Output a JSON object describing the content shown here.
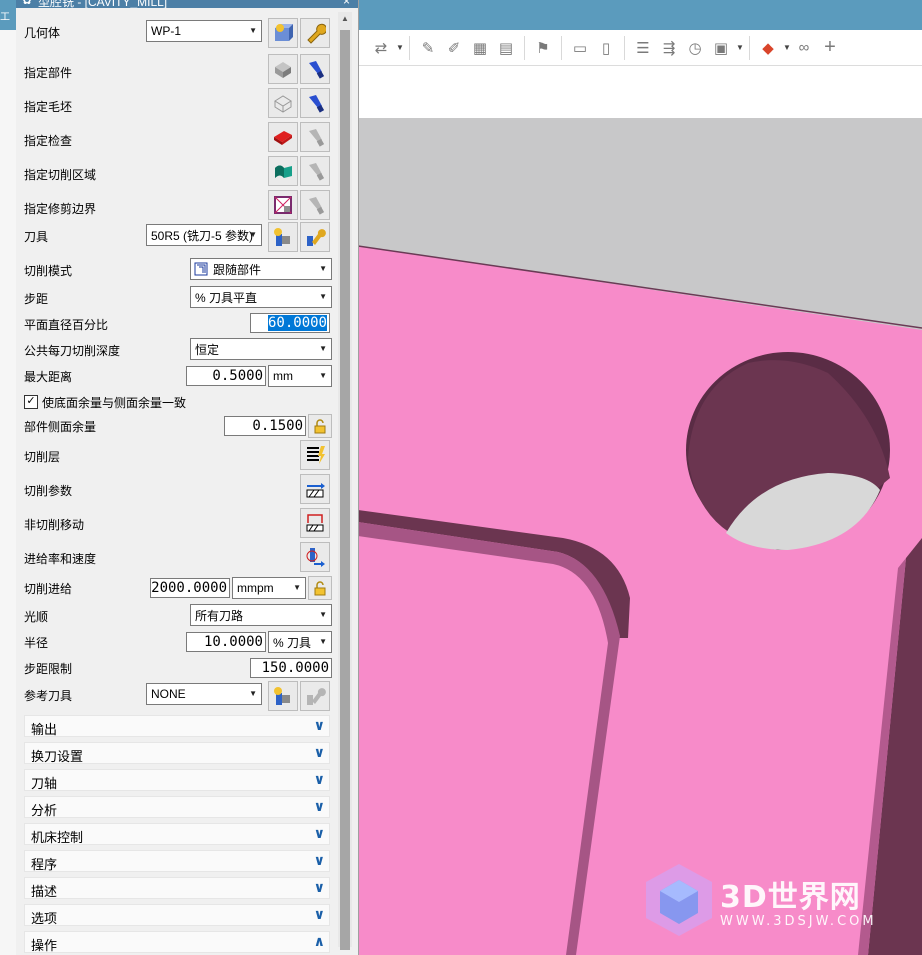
{
  "dialog": {
    "title": "型腔铣 - [CAVITY_MILL]",
    "close": "×",
    "rows": {
      "geometry_label": "几何体",
      "geometry_value": "WP-1",
      "part_label": "指定部件",
      "blank_label": "指定毛坯",
      "check_label": "指定检查",
      "cut_area_label": "指定切削区域",
      "trim_label": "指定修剪边界",
      "tool_label": "刀具",
      "tool_value": "50R5 (铣刀-5 参数)",
      "cut_pattern_label": "切削模式",
      "cut_pattern_value": "跟随部件",
      "stepover_label": "步距",
      "stepover_value": "% 刀具平直",
      "percent_label": "平面直径百分比",
      "percent_value": "60.0000",
      "depth_label": "公共每刀切削深度",
      "depth_value": "恒定",
      "maxdist_label": "最大距离",
      "maxdist_value": "0.5000",
      "maxdist_unit": "mm",
      "floor_check_label": "使底面余量与侧面余量一致",
      "floor_check_mark": "✓",
      "side_stock_label": "部件侧面余量",
      "side_stock_value": "0.1500",
      "levels_label": "切削层",
      "params_label": "切削参数",
      "noncut_label": "非切削移动",
      "feeds_label": "进给率和速度",
      "feed_label": "切削进给",
      "feed_value": "2000.0000",
      "feed_unit": "mmpm",
      "smooth_label": "光顺",
      "smooth_value": "所有刀路",
      "radius_label": "半径",
      "radius_value": "10.0000",
      "radius_unit": "% 刀具",
      "steplimit_label": "步距限制",
      "steplimit_value": "150.0000",
      "reftool_label": "参考刀具",
      "reftool_value": "NONE"
    },
    "sections": [
      {
        "label": "输出",
        "chevron": "∨"
      },
      {
        "label": "换刀设置",
        "chevron": "∨"
      },
      {
        "label": "刀轴",
        "chevron": "∨"
      },
      {
        "label": "分析",
        "chevron": "∨"
      },
      {
        "label": "机床控制",
        "chevron": "∨"
      },
      {
        "label": "程序",
        "chevron": "∨"
      },
      {
        "label": "描述",
        "chevron": "∨"
      },
      {
        "label": "选项",
        "chevron": "∨"
      },
      {
        "label": "操作",
        "chevron": "∧"
      }
    ]
  },
  "app": {
    "left_tab": "工",
    "toolbar_icons": [
      "move-icon",
      "dropdown-arrow",
      "separator",
      "edit-tool-icon",
      "edit-tool-icon-2",
      "grid-icon",
      "table-icon",
      "separator",
      "flag-icon",
      "separator",
      "display-icon",
      "document-icon",
      "separator",
      "list-icon",
      "list-arrow-icon",
      "clock-icon",
      "verify-icon",
      "dropdown-arrow",
      "separator",
      "palette-icon",
      "dropdown-arrow",
      "link-icon",
      "plus-icon"
    ]
  },
  "watermark": {
    "brand": "3D世界网",
    "url": "WWW.3DSJW.COM"
  },
  "colors": {
    "part_pink": "#f78bc9",
    "wall_dark": "#6b3550",
    "background_gray": "#c8c8c9",
    "title_blue": "#4c7fa6",
    "selection_blue": "#0078d7"
  }
}
